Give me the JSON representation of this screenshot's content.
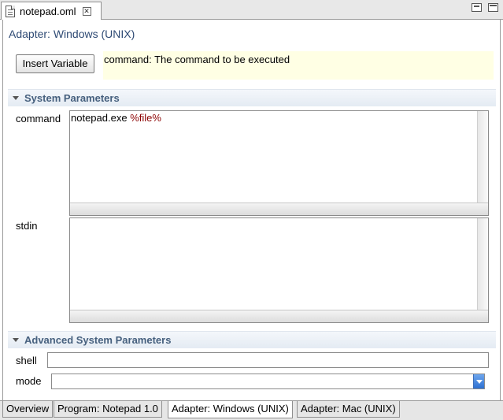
{
  "editor_tab": {
    "label": "notepad.oml",
    "close_glyph": "✕"
  },
  "window_controls": [
    "minimize-icon",
    "maximize-icon"
  ],
  "page_title": "Adapter: Windows (UNIX)",
  "insert_variable_label": "Insert Variable",
  "hint_text": "command: The command to be executed",
  "system_parameters": {
    "title": "System Parameters",
    "command_label": "command",
    "command_value": "notepad.exe",
    "command_variable": "%file%",
    "stdin_label": "stdin",
    "stdin_value": ""
  },
  "advanced_parameters": {
    "title": "Advanced System Parameters",
    "shell_label": "shell",
    "shell_value": "",
    "mode_label": "mode",
    "mode_value": ""
  },
  "page_tabs": [
    {
      "label": "Overview",
      "active": false
    },
    {
      "label": "Program: Notepad 1.0",
      "active": false
    },
    {
      "label": "Adapter: Windows (UNIX)",
      "active": true
    },
    {
      "label": "Adapter: Mac (UNIX)",
      "active": false
    }
  ],
  "colors": {
    "title": "#2e4a74",
    "section_header_text": "#46607e",
    "hint_background": "#ffffe4",
    "variable_text": "#8b0000",
    "select_arrow": "#2d6fd0"
  }
}
